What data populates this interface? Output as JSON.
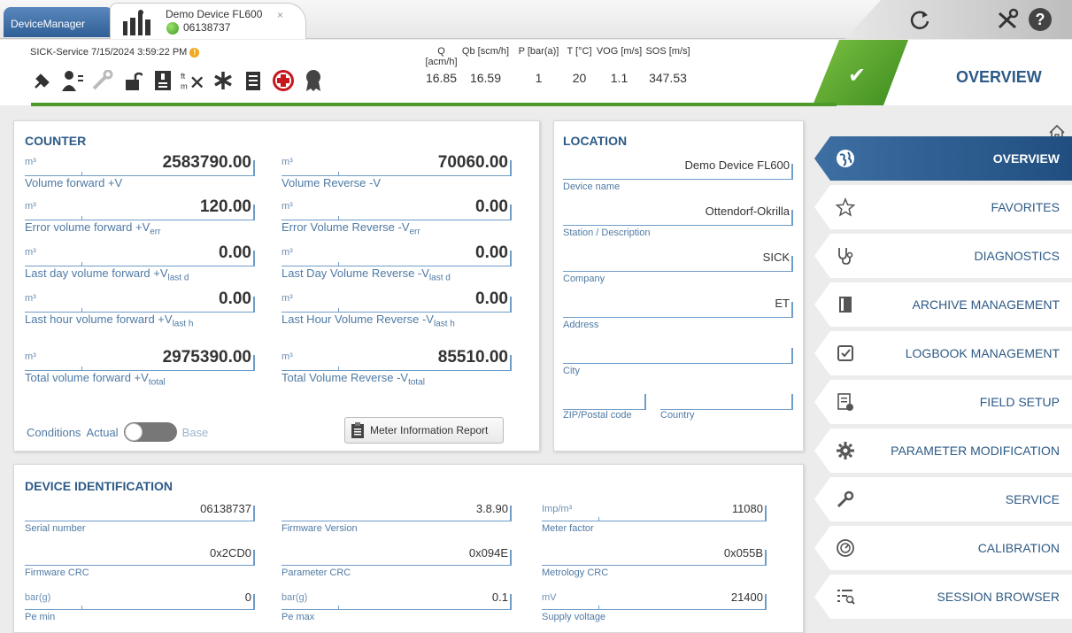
{
  "tabs": {
    "app_label": "DeviceManager",
    "device_title": "Demo Device FL600",
    "device_serial": "06138737",
    "close": "×"
  },
  "status": {
    "service_text": "SICK-Service  7/15/2024  3:59:22 PM",
    "measurements": [
      {
        "label": "Q [acm/h]",
        "value": "16.85"
      },
      {
        "label": "Qb [scm/h]",
        "value": "16.59"
      },
      {
        "label": "P [bar(a)]",
        "value": "1"
      },
      {
        "label": "T [°C]",
        "value": "20"
      },
      {
        "label": "VOG [m/s]",
        "value": "1.1"
      },
      {
        "label": "SOS [m/s]",
        "value": "347.53"
      }
    ],
    "page_heading": "OVERVIEW"
  },
  "counter": {
    "title": "COUNTER",
    "fields": [
      {
        "unit": "m³",
        "value": "2583790.00",
        "label": "Volume forward +V",
        "sub": ""
      },
      {
        "unit": "m³",
        "value": "70060.00",
        "label": "Volume Reverse -V",
        "sub": ""
      },
      {
        "unit": "m³",
        "value": "120.00",
        "label": "Error volume forward +V",
        "sub": "err"
      },
      {
        "unit": "m³",
        "value": "0.00",
        "label": "Error Volume Reverse -V",
        "sub": "err"
      },
      {
        "unit": "m³",
        "value": "0.00",
        "label": "Last day volume forward +V",
        "sub": "last d"
      },
      {
        "unit": "m³",
        "value": "0.00",
        "label": "Last Day Volume Reverse -V",
        "sub": "last d"
      },
      {
        "unit": "m³",
        "value": "0.00",
        "label": "Last hour volume forward +V",
        "sub": "last h"
      },
      {
        "unit": "m³",
        "value": "0.00",
        "label": "Last Hour Volume Reverse -V",
        "sub": "last h"
      },
      {
        "unit": "m³",
        "value": "2975390.00",
        "label": "Total volume forward +V",
        "sub": "total"
      },
      {
        "unit": "m³",
        "value": "85510.00",
        "label": "Total Volume Reverse -V",
        "sub": "total"
      }
    ],
    "conditions_label": "Conditions",
    "actual_label": "Actual",
    "base_label": "Base",
    "report_button": "Meter Information Report"
  },
  "location": {
    "title": "LOCATION",
    "device_name": {
      "value": "Demo Device FL600",
      "label": "Device name"
    },
    "station": {
      "value": "Ottendorf-Okrilla",
      "label": "Station / Description"
    },
    "company": {
      "value": "SICK",
      "label": "Company"
    },
    "address": {
      "value": "ET",
      "label": "Address"
    },
    "city": {
      "value": "",
      "label": "City"
    },
    "zip": {
      "value": "",
      "label": "ZIP/Postal code"
    },
    "country": {
      "value": "",
      "label": "Country"
    }
  },
  "identification": {
    "title": "DEVICE IDENTIFICATION",
    "fields": [
      {
        "unit": "",
        "value": "06138737",
        "label": "Serial number"
      },
      {
        "unit": "",
        "value": "3.8.90",
        "label": "Firmware Version"
      },
      {
        "unit": "Imp/m³",
        "value": "11080",
        "label": "Meter factor"
      },
      {
        "unit": "",
        "value": "0x2CD0",
        "label": "Firmware CRC"
      },
      {
        "unit": "",
        "value": "0x094E",
        "label": "Parameter CRC"
      },
      {
        "unit": "",
        "value": "0x055B",
        "label": "Metrology CRC"
      },
      {
        "unit": "bar(g)",
        "value": "0",
        "label": "Pe min"
      },
      {
        "unit": "bar(g)",
        "value": "0.1",
        "label": "Pe max"
      },
      {
        "unit": "mV",
        "value": "21400",
        "label": "Supply voltage"
      }
    ]
  },
  "nav": {
    "items": [
      {
        "label": "OVERVIEW",
        "icon": "globe-icon",
        "active": true
      },
      {
        "label": "FAVORITES",
        "icon": "star-icon",
        "active": false
      },
      {
        "label": "DIAGNOSTICS",
        "icon": "stethoscope-icon",
        "active": false
      },
      {
        "label": "ARCHIVE MANAGEMENT",
        "icon": "archive-icon",
        "active": false
      },
      {
        "label": "LOGBOOK MANAGEMENT",
        "icon": "logbook-icon",
        "active": false
      },
      {
        "label": "FIELD SETUP",
        "icon": "field-setup-icon",
        "active": false
      },
      {
        "label": "PARAMETER MODIFICATION",
        "icon": "gear-icon",
        "active": false
      },
      {
        "label": "SERVICE",
        "icon": "wrench-icon",
        "active": false
      },
      {
        "label": "CALIBRATION",
        "icon": "calibration-icon",
        "active": false
      },
      {
        "label": "SESSION BROWSER",
        "icon": "session-browser-icon",
        "active": false
      }
    ]
  },
  "colors": {
    "accent_blue": "#2d5a86",
    "status_green": "#4c9a2a",
    "nav_active": "#2f5f92"
  }
}
